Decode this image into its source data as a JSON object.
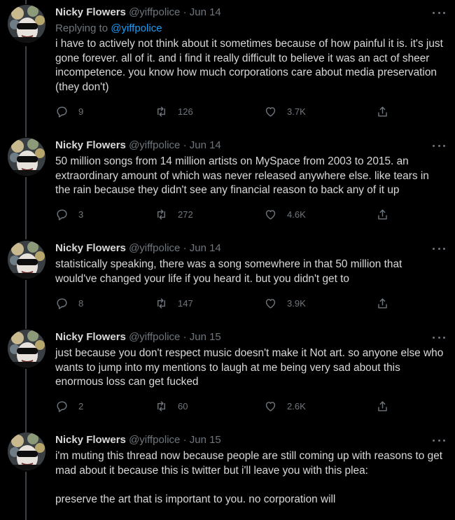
{
  "author": {
    "name": "Nicky Flowers",
    "handle": "@yiffpolice",
    "separator": "·"
  },
  "colors": {
    "background": "#000000",
    "text": "#d9d9d9",
    "muted": "#6e767d",
    "link": "#1d9bf0",
    "thread_line": "#3d4147"
  },
  "icons": [
    "reply-icon",
    "retweet-icon",
    "like-icon",
    "share-icon",
    "more-icon"
  ],
  "tweets": [
    {
      "date": "Jun 14",
      "replying_prefix": "Replying to",
      "replying_to": "@yiffpolice",
      "text": "i have to actively not think about it sometimes because of how painful it is. it's just gone forever. all of it. and i find it really difficult to believe it was an act of sheer incompetence. you know how much corporations care about media preservation (they don't)",
      "replies": "9",
      "retweets": "126",
      "likes": "3.7K"
    },
    {
      "date": "Jun 14",
      "text": "50 million songs from 14 million artists on MySpace from 2003 to 2015. an extraordinary amount of which was never released anywhere else. like tears in the rain because they didn't see any financial reason to back any of it up",
      "replies": "3",
      "retweets": "272",
      "likes": "4.6K"
    },
    {
      "date": "Jun 14",
      "text": "statistically speaking, there was a song somewhere in that 50 million that would've changed your life if you heard it. but you didn't get to",
      "replies": "8",
      "retweets": "147",
      "likes": "3.9K"
    },
    {
      "date": "Jun 15",
      "text": "just because you don't respect music doesn't make it Not art. so anyone else who wants to jump into my mentions to laugh at me being very sad about this enormous loss can get fucked",
      "replies": "2",
      "retweets": "60",
      "likes": "2.6K"
    },
    {
      "date": "Jun 15",
      "text": "i'm muting this thread now because people are still coming up with reasons to get mad about it because this is twitter but i'll leave you with this plea:\n\npreserve the art that is important to you. no corporation will"
    }
  ]
}
